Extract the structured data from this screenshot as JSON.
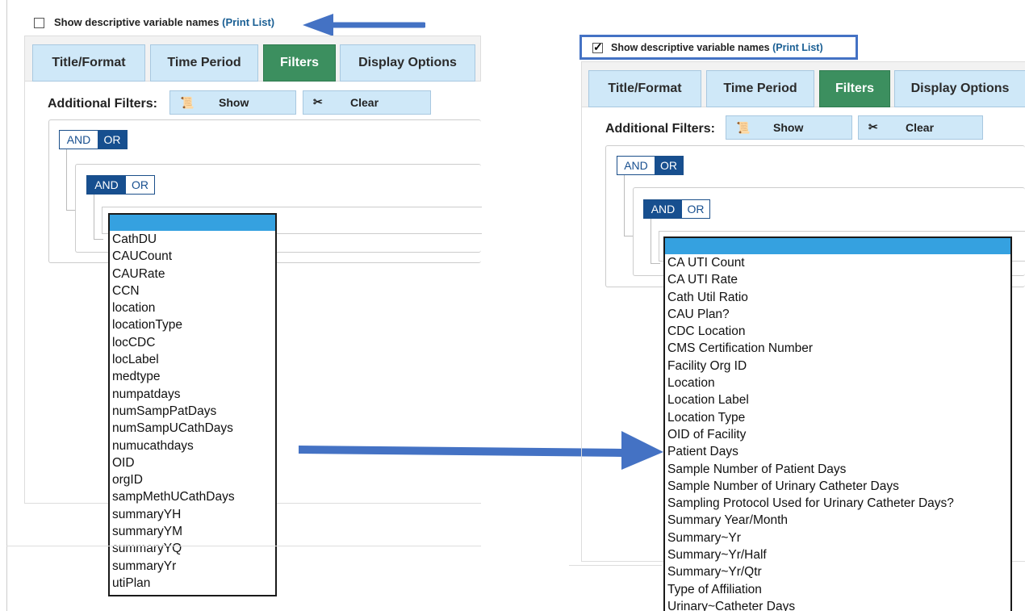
{
  "left": {
    "checkbox": {
      "label": "Show descriptive variable names",
      "link": "(Print List)",
      "checked": false
    },
    "tabs": [
      "Title/Format",
      "Time Period",
      "Filters",
      "Display Options"
    ],
    "active_tab": "Filters",
    "additional_filters_label": "Additional Filters:",
    "show_button": "Show",
    "clear_button": "Clear",
    "outer_toggle": {
      "and": "AND",
      "or": "OR",
      "selected": "OR"
    },
    "inner_toggle": {
      "and": "AND",
      "or": "OR",
      "selected": "AND"
    },
    "dropdown_options": [
      "CathDU",
      "CAUCount",
      "CAURate",
      "CCN",
      "location",
      "locationType",
      "locCDC",
      "locLabel",
      "medtype",
      "numpatdays",
      "numSampPatDays",
      "numSampUCathDays",
      "numucathdays",
      "OID",
      "orgID",
      "sampMethUCathDays",
      "summaryYH",
      "summaryYM",
      "summaryYQ",
      "summaryYr",
      "utiPlan"
    ]
  },
  "right": {
    "checkbox": {
      "label": "Show descriptive variable names",
      "link": "(Print List)",
      "checked": true
    },
    "tabs": [
      "Title/Format",
      "Time Period",
      "Filters",
      "Display Options"
    ],
    "active_tab": "Filters",
    "additional_filters_label": "Additional Filters:",
    "show_button": "Show",
    "clear_button": "Clear",
    "outer_toggle": {
      "and": "AND",
      "or": "OR",
      "selected": "OR"
    },
    "inner_toggle": {
      "and": "AND",
      "or": "OR",
      "selected": "AND"
    },
    "dropdown_options": [
      "CA UTI Count",
      "CA UTI Rate",
      "Cath Util Ratio",
      "CAU Plan?",
      "CDC Location",
      "CMS Certification Number",
      "Facility Org ID",
      "Location",
      "Location Label",
      "Location Type",
      "OID of Facility",
      "Patient Days",
      "Sample Number of Patient Days",
      "Sample Number of Urinary Catheter Days",
      "Sampling Protocol Used for Urinary Catheter Days?",
      "Summary Year/Month",
      "Summary~Yr",
      "Summary~Yr/Half",
      "Summary~Yr/Qtr",
      "Type of Affiliation",
      "Urinary~Catheter Days"
    ]
  },
  "colors": {
    "arrow": "#4472c4",
    "highlight_box": "#4472c4",
    "tab": "#cfe8f8",
    "active_tab": "#3c8f5f",
    "toggle_on": "#174f8f",
    "dropdown_selected": "#35a1e0"
  },
  "icons": {
    "show": "scroll-icon",
    "clear": "scissors-icon",
    "checkmark": "check-icon",
    "arrows": "arrow-icon"
  }
}
